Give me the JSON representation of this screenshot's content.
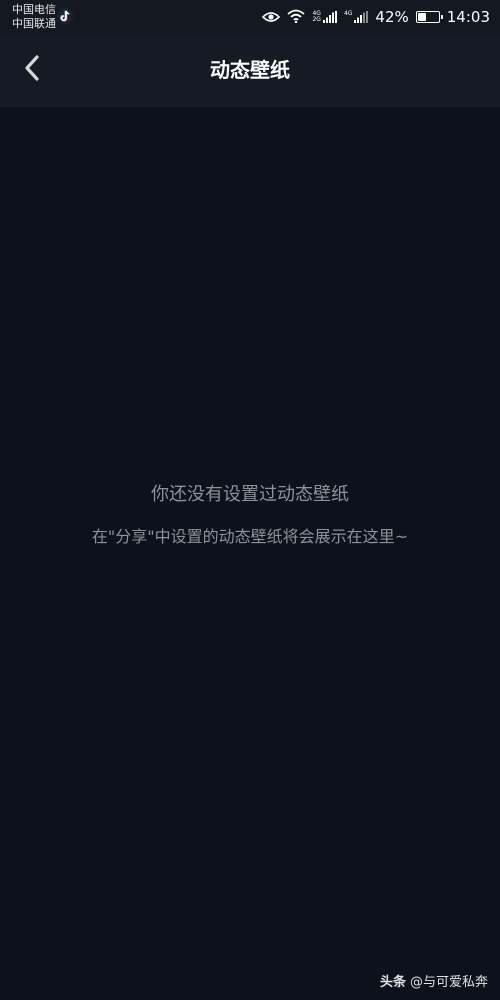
{
  "status_bar": {
    "carrier_1": "中国电信",
    "carrier_2": "中国联通",
    "network_tag_1_top": "4G",
    "network_tag_1_bottom": "2G",
    "network_tag_2": "4G",
    "battery_percent": "42%",
    "battery_level": 0.42,
    "time": "14:03",
    "icons": [
      "tiktok-icon",
      "eye-icon",
      "wifi-icon",
      "signal-icon",
      "signal-icon",
      "battery-charging-icon"
    ]
  },
  "nav": {
    "back_icon": "chevron-left-icon",
    "title": "动态壁纸"
  },
  "empty_state": {
    "title": "你还没有设置过动态壁纸",
    "description": "在\"分享\"中设置的动态壁纸将会展示在这里~"
  },
  "watermark": {
    "brand": "头条",
    "handle": "@与可爱私奔"
  },
  "colors": {
    "background": "#0d111b",
    "nav_background": "#161a24",
    "secondary_text": "#8e9199",
    "primary_text": "#ffffff"
  }
}
